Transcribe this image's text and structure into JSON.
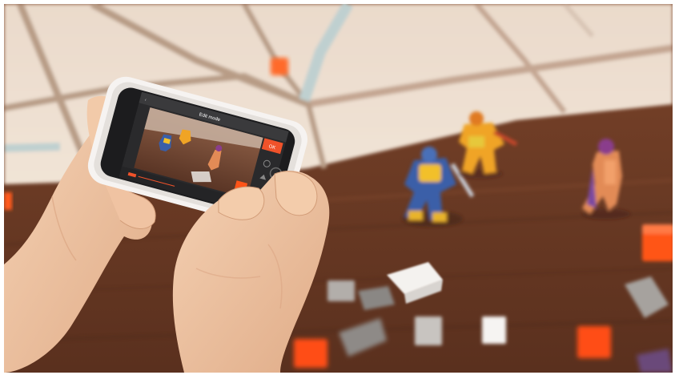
{
  "photo": {
    "subject": "hands-holding-phone-filming-toy-figures",
    "colors": {
      "rug": "#efe1d2",
      "rug_stripe": "#b89c86",
      "rug_blue_stripe": "#bfd0d0",
      "floor": "#6a3a24",
      "floor_dark": "#4e2a19",
      "skin": "#f0c7a7",
      "skin_shade": "#d9a27f",
      "phone_case": "#f6f3f1",
      "app_accent": "#f0522a",
      "app_bar": "#3a3a3c",
      "brick_orange": "#ff4e14",
      "brick_white": "#f4f2ef",
      "brick_grey": "#9c9894"
    }
  },
  "app": {
    "title": "Edit mode",
    "ok_label": "OK"
  }
}
